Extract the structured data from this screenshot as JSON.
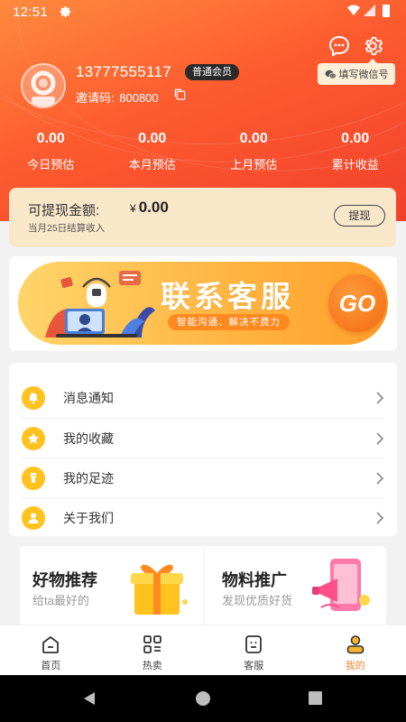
{
  "status_bar": {
    "time": "12:51"
  },
  "profile": {
    "username": "13777555117",
    "member_badge": "普通会员",
    "invite_label": "邀请码:",
    "invite_code": "800800",
    "wechat_button": "填写微信号"
  },
  "stats": [
    {
      "value": "0.00",
      "label": "今日预估"
    },
    {
      "value": "0.00",
      "label": "本月预估"
    },
    {
      "value": "0.00",
      "label": "上月预估"
    },
    {
      "value": "0.00",
      "label": "累计收益"
    }
  ],
  "withdraw": {
    "label": "可提现金额:",
    "currency": "¥",
    "amount": "0.00",
    "note": "当月25日结算收入",
    "button": "提现"
  },
  "banner": {
    "title": "联系客服",
    "subtitle": "智能沟通、解决不费力",
    "go": "GO"
  },
  "menu": [
    {
      "label": "消息通知",
      "icon": "bell-icon"
    },
    {
      "label": "我的收藏",
      "icon": "star-icon"
    },
    {
      "label": "我的足迹",
      "icon": "footprint-icon"
    },
    {
      "label": "关于我们",
      "icon": "user-icon"
    }
  ],
  "promos": [
    {
      "title": "好物推荐",
      "subtitle": "给ta最好的",
      "icon": "gift-icon"
    },
    {
      "title": "物料推广",
      "subtitle": "发现优质好货",
      "icon": "megaphone-phone-icon"
    }
  ],
  "tabs": [
    {
      "label": "首页",
      "icon": "home-icon",
      "active": false
    },
    {
      "label": "热卖",
      "icon": "grid-list-icon",
      "active": false
    },
    {
      "label": "客服",
      "icon": "service-icon",
      "active": false
    },
    {
      "label": "我的",
      "icon": "profile-icon",
      "active": true
    }
  ],
  "colors": {
    "header_start": "#ff8a3d",
    "header_end": "#f2402c",
    "accent": "#f3862a",
    "withdraw_card": "#f8e7c9",
    "menu_icon": "#ffc21f"
  }
}
